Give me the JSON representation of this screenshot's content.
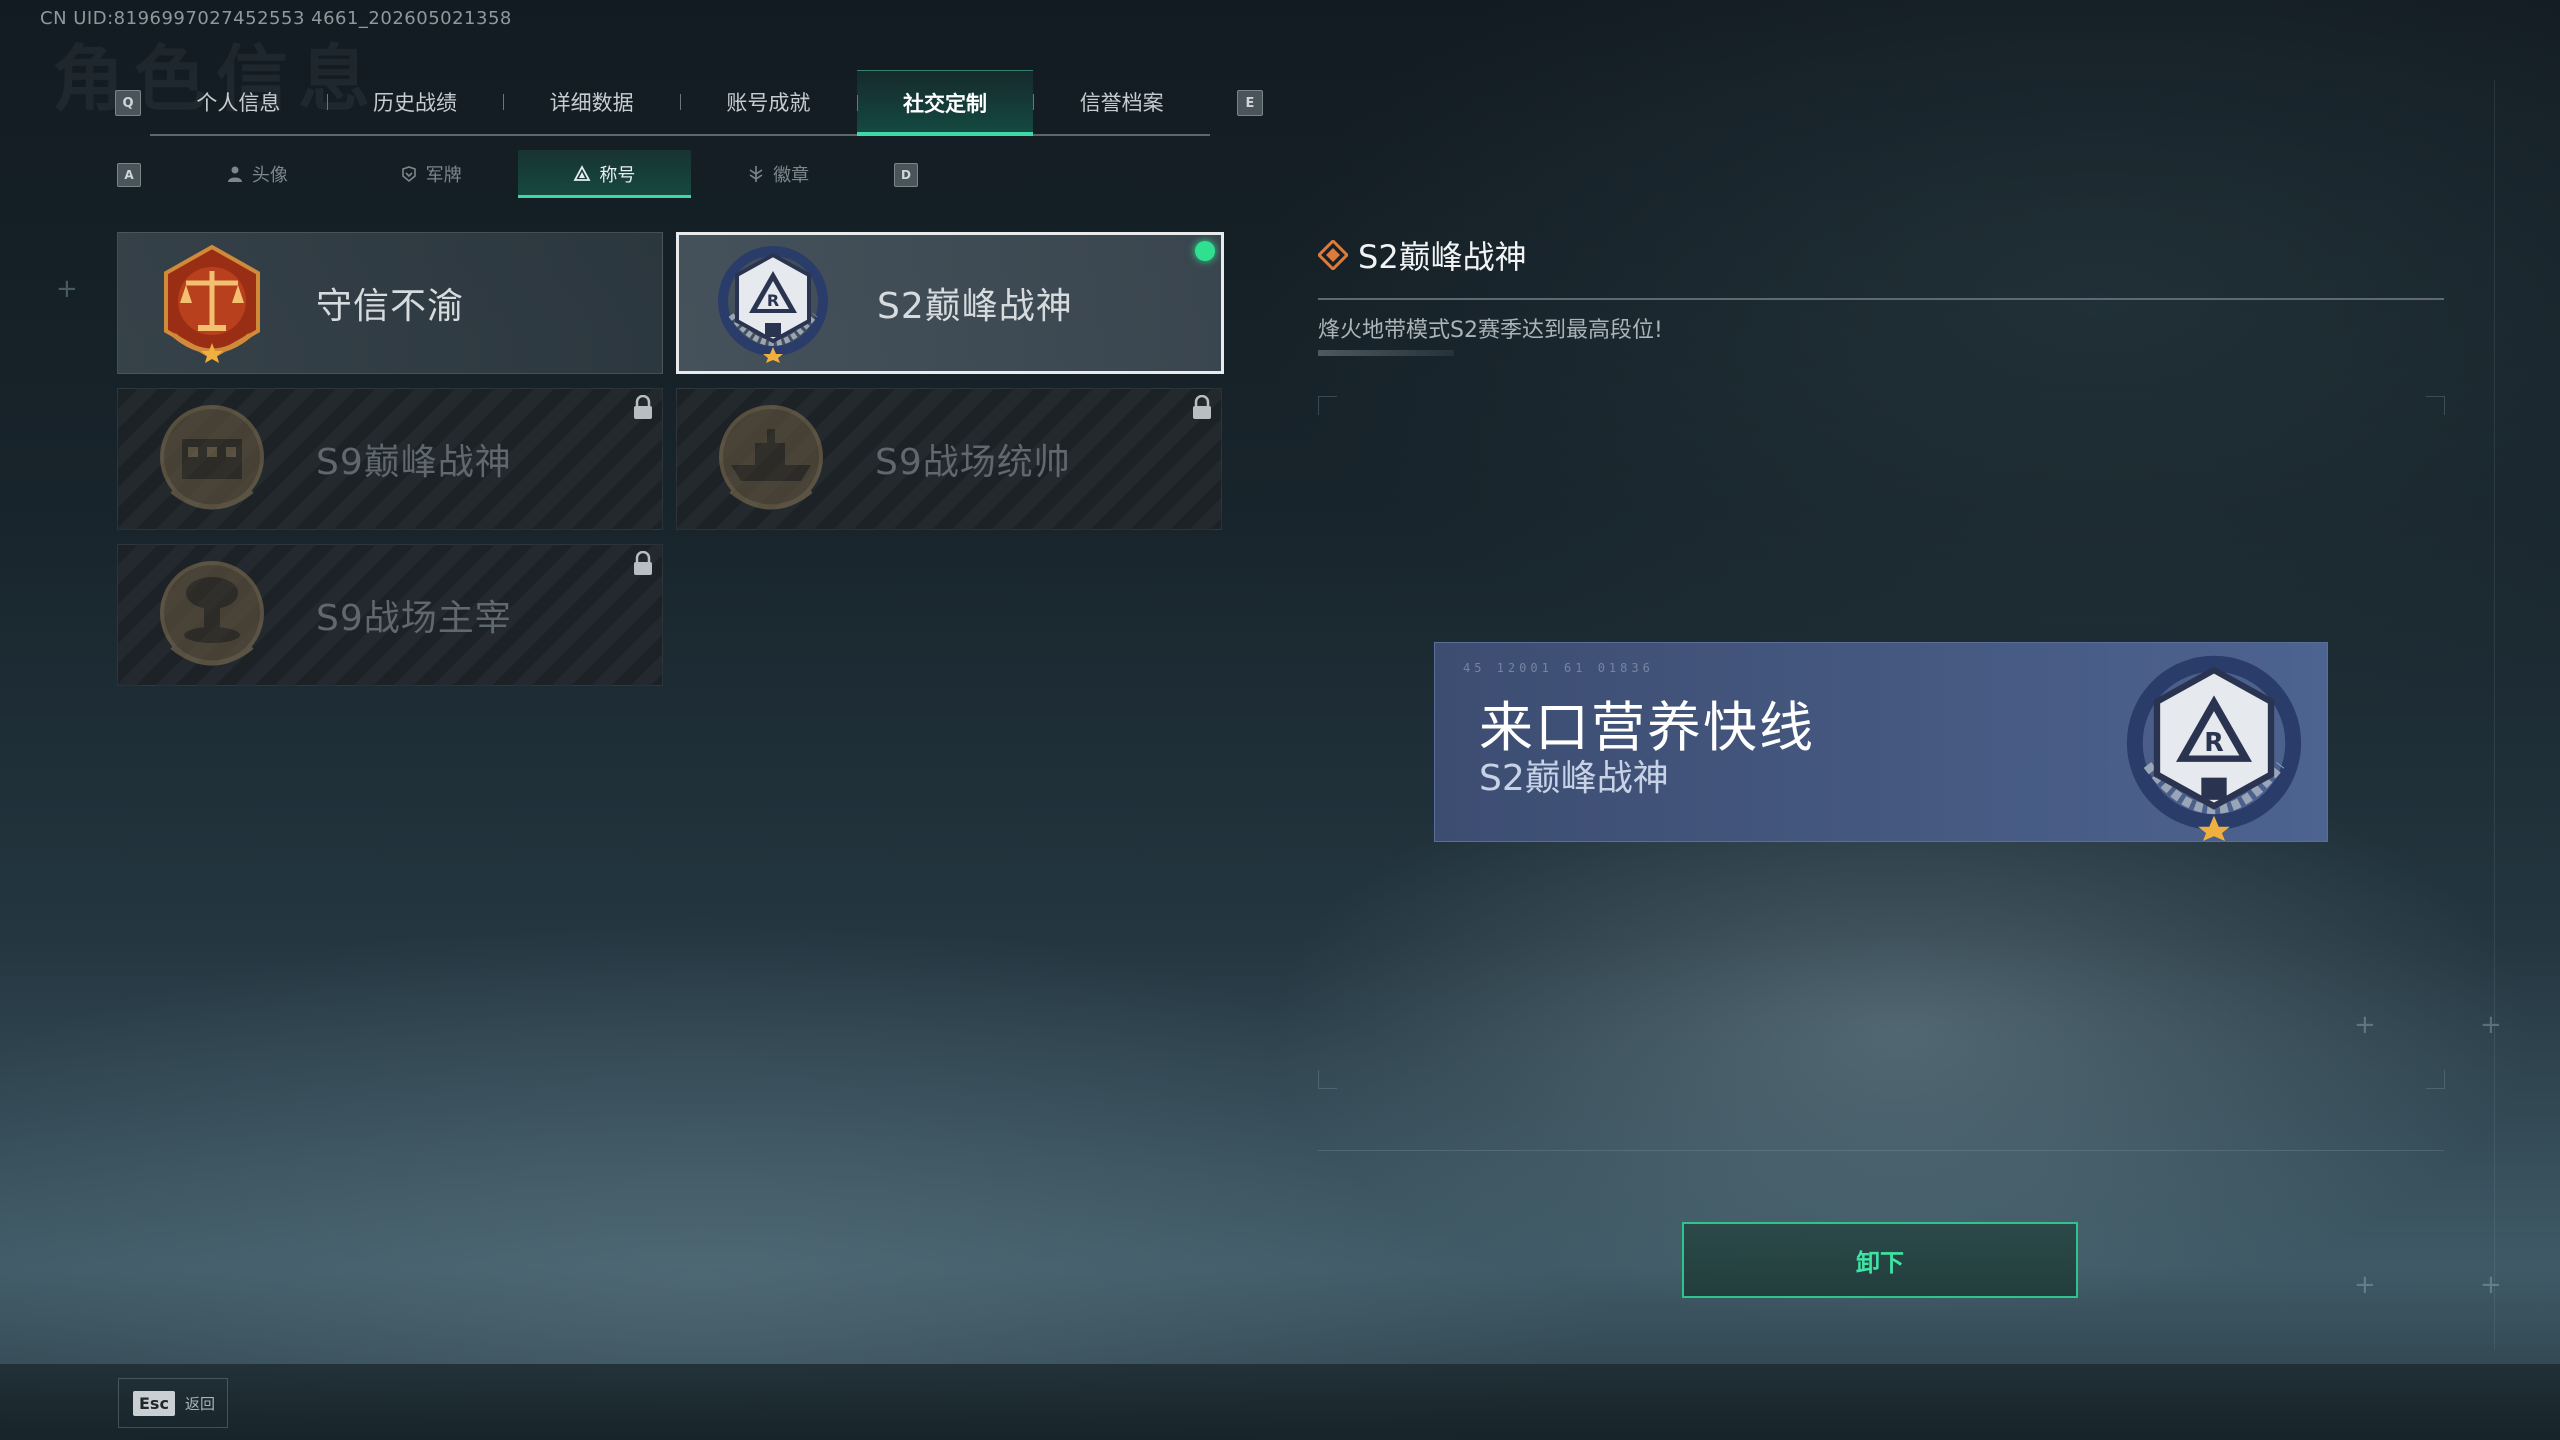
{
  "uid": "CN UID:8196997027452553 4661_202605021358",
  "keys": {
    "prev_tab": "Q",
    "next_tab": "E",
    "prev_sub": "A",
    "next_sub": "D",
    "esc": "Esc"
  },
  "tabs": [
    {
      "label": "个人信息"
    },
    {
      "label": "历史战绩"
    },
    {
      "label": "详细数据"
    },
    {
      "label": "账号成就"
    },
    {
      "label": "社交定制",
      "active": true
    },
    {
      "label": "信誉档案"
    }
  ],
  "subtabs": [
    {
      "label": "头像",
      "icon": "person-icon"
    },
    {
      "label": "军牌",
      "icon": "dogtag-icon"
    },
    {
      "label": "称号",
      "icon": "title-triangle-icon",
      "active": true
    },
    {
      "label": "徽章",
      "icon": "badge-icon"
    }
  ],
  "titles": [
    {
      "name": "守信不渝",
      "state": "owned",
      "emblem": "scales-emblem"
    },
    {
      "name": "S2巅峰战神",
      "state": "selected",
      "emblem": "r-shield-emblem",
      "equipped": true
    },
    {
      "name": "S9巅峰战神",
      "state": "locked",
      "emblem": "fortress-emblem"
    },
    {
      "name": "S9战场统帅",
      "state": "locked",
      "emblem": "warship-emblem"
    },
    {
      "name": "S9战场主宰",
      "state": "locked",
      "emblem": "mushroom-cloud-emblem"
    }
  ],
  "detail": {
    "title": "S2巅峰战神",
    "description": "烽火地带模式S2赛季达到最高段位!",
    "preview_player_name": "来口营养快线",
    "preview_title": "S2巅峰战神",
    "preview_code": "45 12001 61 01836"
  },
  "unequip_label": "卸下",
  "back_label": "返回",
  "colors": {
    "accent": "#3fd8a6",
    "equipped_dot": "#2ee08f",
    "banner": "#465a82",
    "diamond": "#e07a3a"
  }
}
